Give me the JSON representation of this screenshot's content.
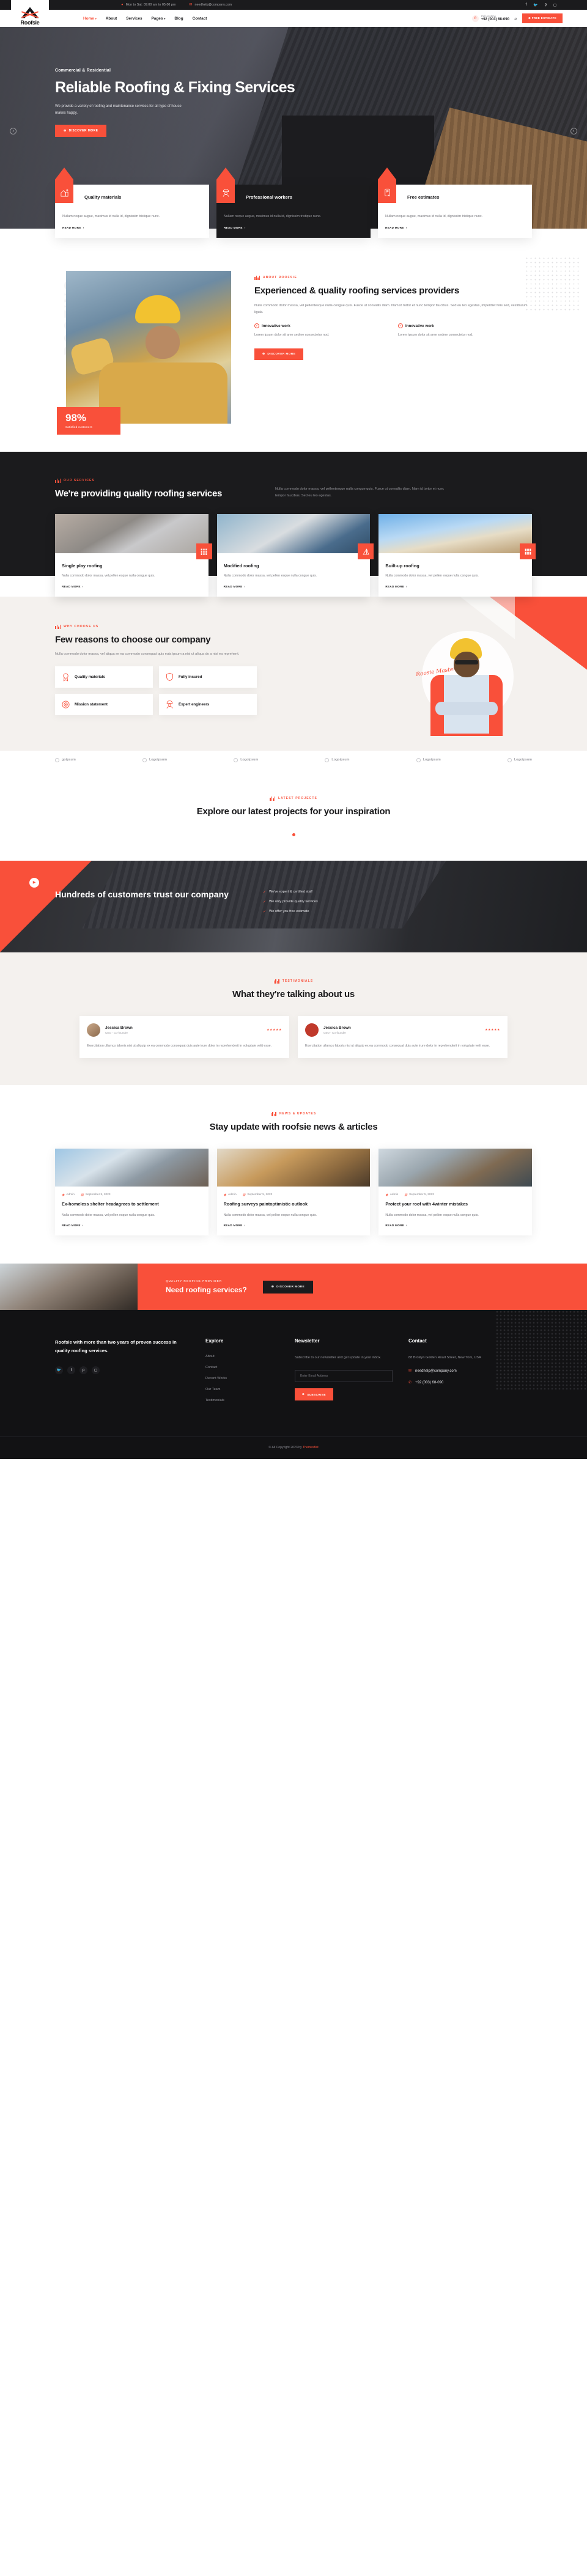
{
  "topbar": {
    "hours": "Mon to Sat: 09:00 am to 05:00 pm",
    "email": "needhelp@company.com",
    "socials": [
      "facebook-icon",
      "twitter-icon",
      "pinterest-icon",
      "instagram-icon"
    ]
  },
  "header": {
    "brand": "Roofsie",
    "nav": [
      {
        "label": "Home",
        "active": true,
        "caret": true
      },
      {
        "label": "About",
        "active": false,
        "caret": false
      },
      {
        "label": "Services",
        "active": false,
        "caret": false
      },
      {
        "label": "Pages",
        "active": false,
        "caret": true
      },
      {
        "label": "Blog",
        "active": false,
        "caret": false
      },
      {
        "label": "Contact",
        "active": false,
        "caret": false
      }
    ],
    "call_label": "Call Anytime",
    "call_number": "+92 (003) 68-090",
    "estimate_button": "FREE ESTIMATE"
  },
  "hero": {
    "subtitle": "Commercial & Residential",
    "title": "Reliable Roofing & Fixing Services",
    "desc": "We provide a variety of roofing and maintenance services for all type of house makes happy.",
    "button": "DISCOVER MORE"
  },
  "features": [
    {
      "title": "Quality materials",
      "desc": "Nullam neque augue, maximus id nulla id, dignissim tristique nunc.",
      "more": "READ MORE",
      "icon": "house-icon"
    },
    {
      "title": "Professional workers",
      "desc": "Nullam neque augue, maximus id nulla id, dignissim tristique nunc.",
      "more": "READ MORE",
      "icon": "worker-icon"
    },
    {
      "title": "Free estimates",
      "desc": "Nullam neque augue, maximus id nulla id, dignissim tristique nunc.",
      "more": "READ MORE",
      "icon": "estimate-icon"
    }
  ],
  "about": {
    "label": "ABOUT ROOFSIE",
    "title": "Experienced & quality roofing services providers",
    "desc": "Nulla commodo dolor massa, vel pellentesque nulla congue quis. Fusce ut convallis diam. Nam id tortor et nunc tempor faucibus. Sed eu leo egestas, imperdiet felis sed, vestibulum ligula.",
    "vertical_word": "ROOFING",
    "stat_number": "98%",
    "stat_text": "Satisfied customers",
    "points": [
      {
        "title": "Innovative work",
        "desc": "Lorem ipsum dolor sit ame sedme consectetur nod."
      },
      {
        "title": "Innovative work",
        "desc": "Lorem ipsum dolor sit ame sedme consectetur nod."
      }
    ],
    "button": "DISCOVER MORE"
  },
  "services": {
    "label": "OUR SERVICES",
    "title": "We're providing quality roofing services",
    "desc": "Nulla commodo dolor massa, vel pellentesque nulla congue quis. Fusce ut convallis diam. Nam id tortor et nunc tempor faucibus. Sed eu leo egestas.",
    "cards": [
      {
        "title": "Single play roofing",
        "desc": "Nulla commodo dolor massa, vel pellen esque nulla congue quis.",
        "more": "READ MORE",
        "icon": "shingles-icon"
      },
      {
        "title": "Modified roofing",
        "desc": "Nulla commodo dolor massa, vel pellen esque nulla congue quis.",
        "more": "READ MORE",
        "icon": "roof-angle-icon"
      },
      {
        "title": "Built-up roofing",
        "desc": "Nulla commodo dolor massa, vel pellen esque nulla congue quis.",
        "more": "READ MORE",
        "icon": "planks-icon"
      }
    ]
  },
  "why": {
    "label": "WHY CHOOSE US",
    "title": "Few reasons to choose our company",
    "desc": "Nulla commodo dolor massa, vel aliqua se ea commodo consequat quis eula ipsum a nisi ut aliqua do a nisi ea reprehent.",
    "signature": "Roosie Masters",
    "cards": [
      {
        "title": "Quality materials",
        "icon": "medal-icon"
      },
      {
        "title": "Fully insured",
        "icon": "shield-icon"
      },
      {
        "title": "Mission statement",
        "icon": "target-icon"
      },
      {
        "title": "Expert engineers",
        "icon": "engineer-icon"
      }
    ]
  },
  "logos": [
    "gotpsum",
    "Logoipsum",
    "Logoipsum",
    "Logoipsum",
    "Logoipsum",
    "Logoipsum"
  ],
  "projects": {
    "label": "LATEST PROJECTS",
    "title": "Explore our latest projects for your inspiration"
  },
  "videocta": {
    "title": "Hundreds of customers trust our company",
    "play": "play-icon",
    "items": [
      "We've expert & certified staff",
      "We only provide quality services",
      "We offer you free estimate"
    ]
  },
  "testimonials": {
    "label": "TESTIMONIALS",
    "title": "What they're talking about us",
    "items": [
      {
        "name": "Jessica Brown",
        "role": "CEO - Co-founder",
        "stars": "★★★★★",
        "quote": "Exercitation ullamco laboris nisi ut aliquip ex ea commodo consequat duis aute irure dolor in reprehenderit in voluptate velit esse."
      },
      {
        "name": "Jessica Brown",
        "role": "CEO - Co-founder",
        "stars": "★★★★★",
        "quote": "Exercitation ullamco laboris nisi ut aliquip ex ea commodo consequat duis aute irure dolor in reprehenderit in voluptate velit esse."
      }
    ]
  },
  "news": {
    "label": "NEWS & UPDATES",
    "title": "Stay update with roofsie news & articles",
    "items": [
      {
        "author": "Admin",
        "date": "September 5, 2023",
        "title": "Ex-homeless shelter headagrees to settlement",
        "desc": "Nulla commodo dolor massa, vel pellen esque nulla congue quis.",
        "more": "READ MORE"
      },
      {
        "author": "Admin",
        "date": "September 5, 2023",
        "title": "Roofing surveys paintoptimistic outlook",
        "desc": "Nulla commodo dolor massa, vel pellen esque nulla congue quis.",
        "more": "READ MORE"
      },
      {
        "author": "Admin",
        "date": "September 5, 2023",
        "title": "Protect your roof with 4winter mistakes",
        "desc": "Nulla commodo dolor massa, vel pellen esque nulla congue quis.",
        "more": "READ MORE"
      }
    ]
  },
  "banner": {
    "label": "QUALITY ROOFING PROVIDER",
    "title": "Need roofing services?",
    "button": "DISCOVER MORE"
  },
  "footer": {
    "about": "Roofsie with more than two years of proven success in quality roofing services.",
    "socials": [
      "twitter-icon",
      "facebook-icon",
      "pinterest-icon",
      "instagram-icon"
    ],
    "explore_title": "Explore",
    "explore": [
      "About",
      "Contact",
      "Recent Works",
      "Our Team",
      "Testimonials"
    ],
    "newsletter_title": "Newsletter",
    "newsletter_desc": "Subscribe to our newsletter and get update in your inbox.",
    "newsletter_placeholder": "Enter Email Address",
    "subscribe_button": "SUBSCRIBE",
    "contact_title": "Contact",
    "address": "88 Broklyn Golden Road Street, New York, USA",
    "email": "needhelp@company.com",
    "phone": "+92 (003) 68-090",
    "copyright": "© All Copyright 2023 by ",
    "copyright_brand": "Themesflat"
  },
  "colors": {
    "accent": "#f9503a",
    "dark": "#1b1b1d",
    "cream": "#f4f1ee"
  }
}
